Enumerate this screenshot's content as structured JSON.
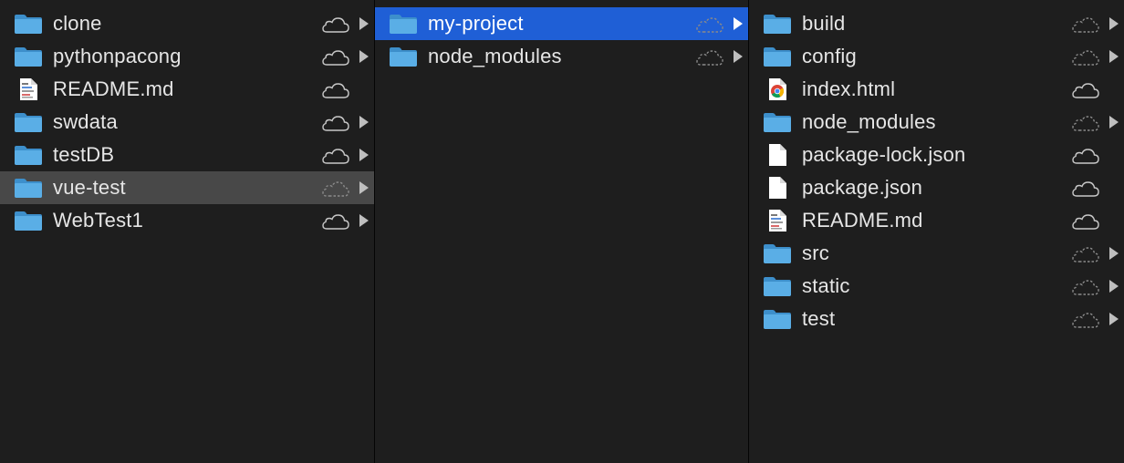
{
  "columns": [
    {
      "name": "column-1",
      "items": [
        {
          "label": "clone",
          "icon": "folder-icon",
          "cloud": "cloud-solid",
          "has_children": true,
          "state": ""
        },
        {
          "label": "pythonpacong",
          "icon": "folder-icon",
          "cloud": "cloud-solid",
          "has_children": true,
          "state": ""
        },
        {
          "label": "README.md",
          "icon": "markdown-file-icon",
          "cloud": "cloud-solid",
          "has_children": false,
          "state": ""
        },
        {
          "label": "swdata",
          "icon": "folder-icon",
          "cloud": "cloud-solid",
          "has_children": true,
          "state": ""
        },
        {
          "label": "testDB",
          "icon": "folder-icon",
          "cloud": "cloud-solid",
          "has_children": true,
          "state": ""
        },
        {
          "label": "vue-test",
          "icon": "folder-icon",
          "cloud": "cloud-dashed",
          "has_children": true,
          "state": "highlight"
        },
        {
          "label": "WebTest1",
          "icon": "folder-icon",
          "cloud": "cloud-solid",
          "has_children": true,
          "state": ""
        }
      ]
    },
    {
      "name": "column-2",
      "items": [
        {
          "label": "my-project",
          "icon": "folder-icon",
          "cloud": "cloud-dashed",
          "has_children": true,
          "state": "selected"
        },
        {
          "label": "node_modules",
          "icon": "folder-icon",
          "cloud": "cloud-dashed",
          "has_children": true,
          "state": ""
        }
      ]
    },
    {
      "name": "column-3",
      "items": [
        {
          "label": "build",
          "icon": "folder-icon",
          "cloud": "cloud-dashed",
          "has_children": true,
          "state": ""
        },
        {
          "label": "config",
          "icon": "folder-icon",
          "cloud": "cloud-dashed",
          "has_children": true,
          "state": ""
        },
        {
          "label": "index.html",
          "icon": "chrome-html-icon",
          "cloud": "cloud-solid",
          "has_children": false,
          "state": ""
        },
        {
          "label": "node_modules",
          "icon": "folder-icon",
          "cloud": "cloud-dashed",
          "has_children": true,
          "state": ""
        },
        {
          "label": "package-lock.json",
          "icon": "blank-file-icon",
          "cloud": "cloud-solid",
          "has_children": false,
          "state": ""
        },
        {
          "label": "package.json",
          "icon": "blank-file-icon",
          "cloud": "cloud-solid",
          "has_children": false,
          "state": ""
        },
        {
          "label": "README.md",
          "icon": "markdown-file-icon",
          "cloud": "cloud-solid",
          "has_children": false,
          "state": ""
        },
        {
          "label": "src",
          "icon": "folder-icon",
          "cloud": "cloud-dashed",
          "has_children": true,
          "state": ""
        },
        {
          "label": "static",
          "icon": "folder-icon",
          "cloud": "cloud-dashed",
          "has_children": true,
          "state": ""
        },
        {
          "label": "test",
          "icon": "folder-icon",
          "cloud": "cloud-dashed",
          "has_children": true,
          "state": ""
        }
      ]
    }
  ],
  "colors": {
    "background": "#1e1e1e",
    "selection": "#1f5fd6",
    "highlight": "#484848",
    "folder": "#5aaee6",
    "text": "#e6e6e6",
    "icon_gray": "#bfbfbf"
  }
}
